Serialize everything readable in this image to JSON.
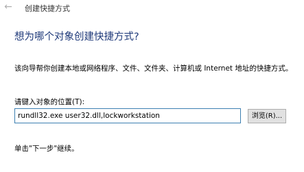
{
  "window": {
    "title": "创建快捷方式",
    "back_icon": "back-arrow-icon"
  },
  "main": {
    "heading": "想为哪个对象创建快捷方式?",
    "description": "该向导帮你创建本地或网络程序、文件、文件夹、计算机或 Internet 地址的快捷方式。",
    "location_label": "请键入对象的位置(T):",
    "location_value": "rundll32.exe user32.dll,lockworkstation",
    "browse_label": "浏览(R)...",
    "hint": "单击\"下一步\"继续。"
  },
  "colors": {
    "heading": "#1f3a7a",
    "input_border": "#3c7fb1",
    "button_bg": "#e1e1e1"
  }
}
